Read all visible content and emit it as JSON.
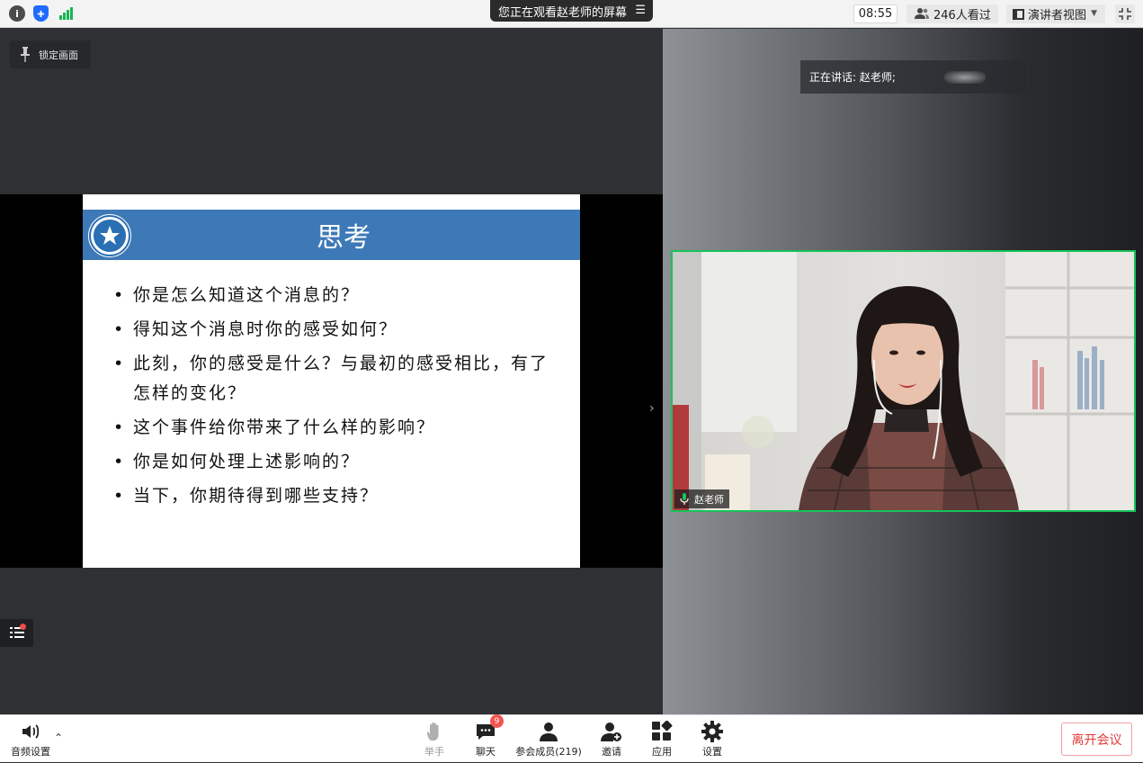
{
  "topbar": {
    "sharing_notice": "您正在观看赵老师的屏幕",
    "clock": "08:55",
    "viewers": "246人看过",
    "view_mode": "演讲者视图",
    "icons": [
      "info-icon",
      "shield-icon",
      "signal-icon",
      "menu-icon",
      "people-icon",
      "layout-icon",
      "exit-fullscreen-icon"
    ]
  },
  "stage": {
    "lock_label": "锁定画面",
    "slide": {
      "title": "思考",
      "bullets": [
        "你是怎么知道这个消息的？",
        "得知这个消息时你的感受如何？",
        "此刻，你的感受是什么？与最初的感受相比，有了怎样的变化？",
        "这个事件给你带来了什么样的影响？",
        "你是如何处理上述影响的？",
        "当下，你期待得到哪些支持？"
      ]
    }
  },
  "right_panel": {
    "speaking_label": "正在讲话: 赵老师;",
    "video_name": "赵老师"
  },
  "toolbar": {
    "audio_label": "音频设置",
    "raise_hand_label": "举手",
    "chat_label": "聊天",
    "chat_badge": "9",
    "participants_label": "参会成员(219)",
    "invite_label": "邀请",
    "apps_label": "应用",
    "settings_label": "设置",
    "leave_label": "离开会议"
  },
  "colors": {
    "accent_green": "#17c35a",
    "slide_blue": "#3e79b7",
    "leave_red": "#e23b3b"
  }
}
